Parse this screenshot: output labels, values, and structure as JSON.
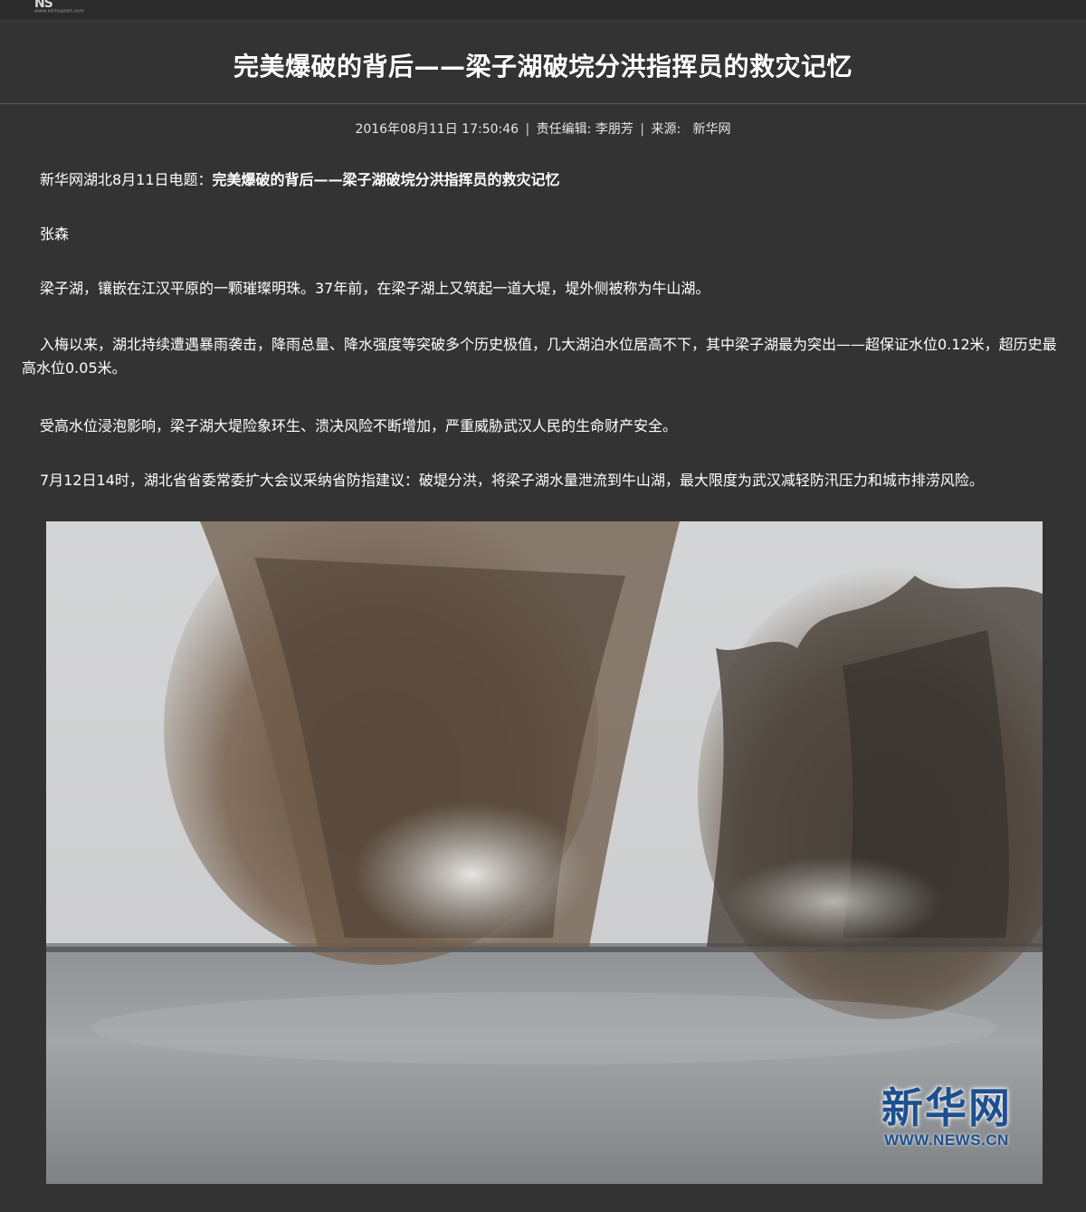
{
  "header": {
    "logo_mark": "NS",
    "logo_url": "www.xinhuanet.com"
  },
  "article": {
    "title": "完美爆破的背后——梁子湖破垸分洪指挥员的救灾记忆",
    "meta": {
      "datetime": "2016年08月11日 17:50:46",
      "editor_label": "责任编辑:",
      "editor": "李朋芳",
      "source_label": "来源:",
      "source": "新华网",
      "separator": "|"
    },
    "dateline_prefix": "新华网湖北8月11日电题：",
    "dateline_title": "完美爆破的背后——梁子湖破垸分洪指挥员的救灾记忆",
    "author": "张森",
    "paragraphs": [
      "梁子湖，镶嵌在江汉平原的一颗璀璨明珠。37年前，在梁子湖上又筑起一道大堤，堤外侧被称为牛山湖。",
      "入梅以来，湖北持续遭遇暴雨袭击，降雨总量、降水强度等突破多个历史极值，几大湖泊水位居高不下，其中梁子湖最为突出——超保证水位0.12米，超历史最高水位0.05米。",
      "受高水位浸泡影响，梁子湖大堤险象环生、溃决风险不断增加，严重威胁武汉人民的生命财产安全。",
      "7月12日14时，湖北省省委常委扩大会议采纳省防指建议：破堤分洪，将梁子湖水量泄流到牛山湖，最大限度为武汉减轻防汛压力和城市排涝风险。"
    ],
    "photo": {
      "watermark_cn": "新华网",
      "watermark_en": "WWW.NEWS.CN"
    }
  },
  "colors": {
    "background": "#333333",
    "text": "#ffffff",
    "watermark": "#1e4f8f"
  }
}
